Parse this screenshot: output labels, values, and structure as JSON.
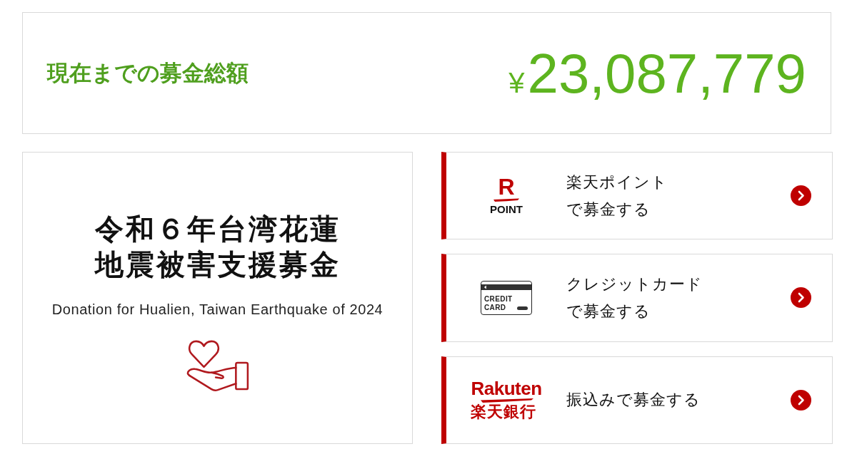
{
  "total": {
    "label": "現在までの募金総額",
    "currency": "¥",
    "amount": "23,087,779"
  },
  "campaign": {
    "title_lines": [
      "令和６年台湾花蓮",
      "地震被害支援募金"
    ],
    "subtitle": "Donation for Hualien, Taiwan Earthquake of 2024"
  },
  "options": [
    {
      "kind": "point",
      "logo_text": [
        "R",
        "POINT"
      ],
      "label_lines": [
        "楽天ポイント",
        "で募金する"
      ]
    },
    {
      "kind": "card",
      "logo_text": [
        "CREDIT",
        "CARD"
      ],
      "label_lines": [
        "クレジットカード",
        "で募金する"
      ]
    },
    {
      "kind": "bank",
      "logo_text": [
        "Rakuten",
        "楽天銀行"
      ],
      "label_lines": [
        "振込みで募金する"
      ]
    }
  ]
}
